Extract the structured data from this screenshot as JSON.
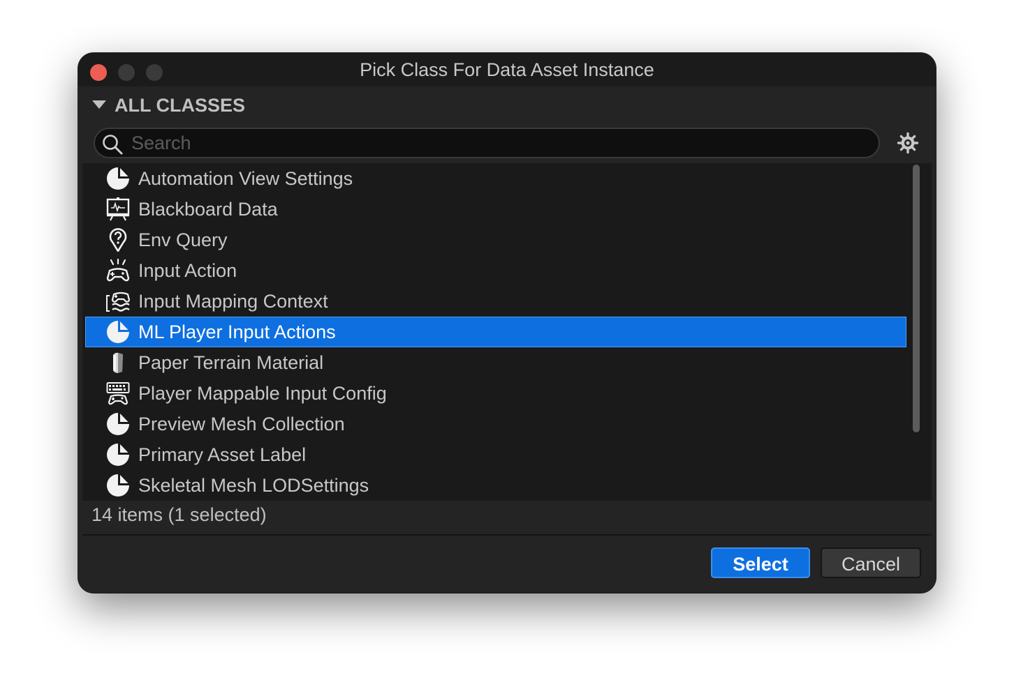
{
  "window": {
    "title": "Pick Class For Data Asset Instance"
  },
  "section": {
    "title": "ALL CLASSES"
  },
  "search": {
    "placeholder": "Search",
    "value": ""
  },
  "items": [
    {
      "label": "Automation View Settings",
      "icon": "data-asset-icon"
    },
    {
      "label": "Blackboard Data",
      "icon": "blackboard-icon"
    },
    {
      "label": "Env Query",
      "icon": "env-query-icon"
    },
    {
      "label": "Input Action",
      "icon": "input-action-icon"
    },
    {
      "label": "Input Mapping Context",
      "icon": "input-mapping-icon"
    },
    {
      "label": "ML Player Input Actions",
      "icon": "data-asset-icon",
      "selected": true
    },
    {
      "label": "Paper Terrain Material",
      "icon": "paper-terrain-icon"
    },
    {
      "label": "Player Mappable Input Config",
      "icon": "keyboard-gamepad-icon"
    },
    {
      "label": "Preview Mesh Collection",
      "icon": "data-asset-icon"
    },
    {
      "label": "Primary Asset Label",
      "icon": "data-asset-icon"
    },
    {
      "label": "Skeletal Mesh LODSettings",
      "icon": "data-asset-icon"
    }
  ],
  "status": {
    "text": "14 items (1 selected)"
  },
  "buttons": {
    "select": "Select",
    "cancel": "Cancel"
  },
  "colors": {
    "accent": "#0e6fe0",
    "close": "#ec5e54",
    "background": "#242424"
  }
}
